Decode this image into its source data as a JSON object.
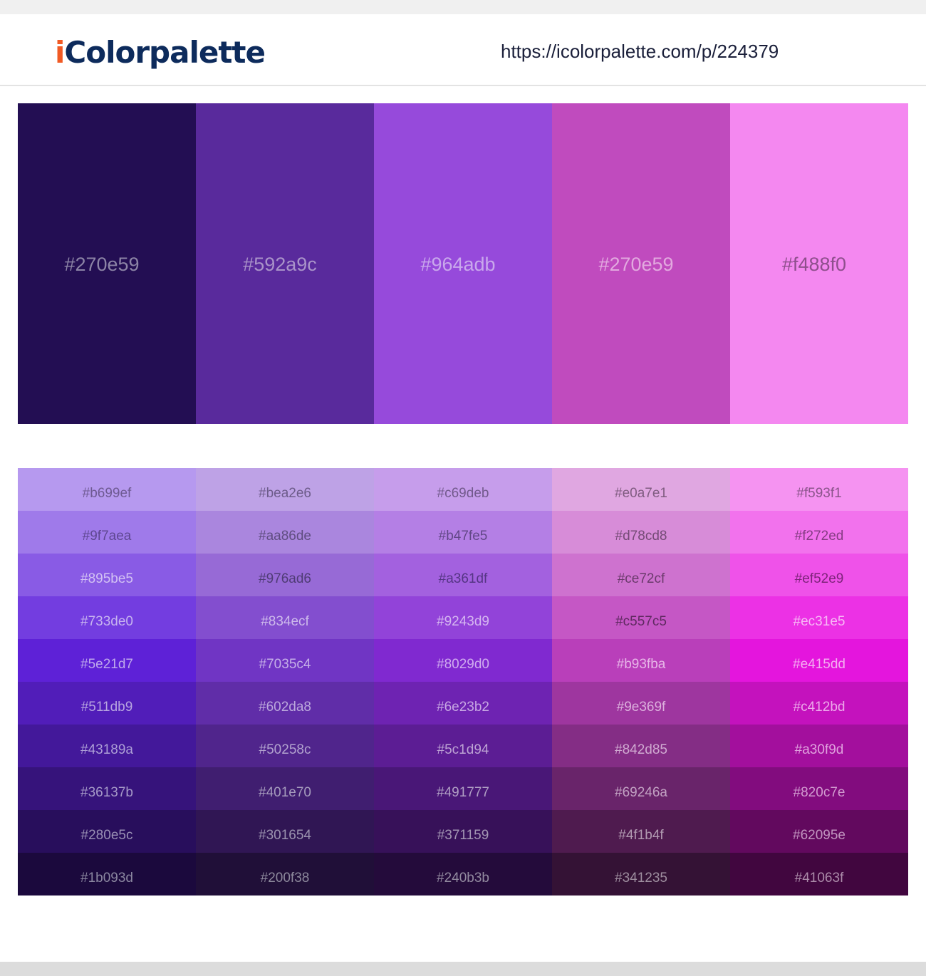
{
  "header": {
    "logo_first": "i",
    "logo_rest": "Colorpalette",
    "url": "https://icolorpalette.com/p/224379"
  },
  "colors": {
    "logo_accent": "#f15a24",
    "logo_main": "#0d2b5c"
  },
  "main_palette": [
    {
      "label": "#270e59",
      "color": "#230e53",
      "text_color": "#8c84a6"
    },
    {
      "label": "#592a9c",
      "color": "#592a9c",
      "text_color": "#a993c9"
    },
    {
      "label": "#964adb",
      "color": "#964adb",
      "text_color": "#c9a8ec"
    },
    {
      "label": "#270e59",
      "color": "#c04bbe",
      "text_color": "#e2a9df"
    },
    {
      "label": "#f488f0",
      "color": "#f488f0",
      "text_color": "#8e4f8c"
    }
  ],
  "shades": [
    {
      "column": 1,
      "cells": [
        {
          "label": "#b699ef",
          "color": "#b699ef",
          "text_color": "#6e5a92"
        },
        {
          "label": "#9f7aea",
          "color": "#9f7aea",
          "text_color": "#5f4892"
        },
        {
          "label": "#895be5",
          "color": "#895be5",
          "text_color": "#d3c2f3"
        },
        {
          "label": "#733de0",
          "color": "#733de0",
          "text_color": "#c7b4ef"
        },
        {
          "label": "#5e21d7",
          "color": "#5e21d7",
          "text_color": "#bea9ec"
        },
        {
          "label": "#511db9",
          "color": "#511db9",
          "text_color": "#b7a4e0"
        },
        {
          "label": "#43189a",
          "color": "#43189a",
          "text_color": "#ad9fd6"
        },
        {
          "label": "#36137b",
          "color": "#36137b",
          "text_color": "#a69ac8"
        },
        {
          "label": "#280e5c",
          "color": "#280e5c",
          "text_color": "#9a91b5"
        },
        {
          "label": "#1b093d",
          "color": "#1b093d",
          "text_color": "#8b87a0"
        }
      ]
    },
    {
      "column": 2,
      "cells": [
        {
          "label": "#bea2e6",
          "color": "#bea2e6",
          "text_color": "#6d5c8a"
        },
        {
          "label": "#aa86de",
          "color": "#aa86de",
          "text_color": "#5f4d80"
        },
        {
          "label": "#976ad6",
          "color": "#976ad6",
          "text_color": "#4f3c75"
        },
        {
          "label": "#834ecf",
          "color": "#834ecf",
          "text_color": "#cdbaeb"
        },
        {
          "label": "#7035c4",
          "color": "#7035c4",
          "text_color": "#c5b0e8"
        },
        {
          "label": "#602da8",
          "color": "#602da8",
          "text_color": "#bba8dc"
        },
        {
          "label": "#50258c",
          "color": "#50258c",
          "text_color": "#b2a3cf"
        },
        {
          "label": "#401e70",
          "color": "#401e70",
          "text_color": "#a69cbd"
        },
        {
          "label": "#301654",
          "color": "#301654",
          "text_color": "#9b93af"
        },
        {
          "label": "#200f38",
          "color": "#200f38",
          "text_color": "#8d899c"
        }
      ]
    },
    {
      "column": 3,
      "cells": [
        {
          "label": "#c69deb",
          "color": "#c69deb",
          "text_color": "#725a8c"
        },
        {
          "label": "#b47fe5",
          "color": "#b47fe5",
          "text_color": "#624787"
        },
        {
          "label": "#a361df",
          "color": "#a361df",
          "text_color": "#553584"
        },
        {
          "label": "#9243d9",
          "color": "#9243d9",
          "text_color": "#d5b6f0"
        },
        {
          "label": "#8029d0",
          "color": "#8029d0",
          "text_color": "#cfabef"
        },
        {
          "label": "#6e23b2",
          "color": "#6e23b2",
          "text_color": "#c7a7e3"
        },
        {
          "label": "#5c1d94",
          "color": "#5c1d94",
          "text_color": "#bda3d4"
        },
        {
          "label": "#491777",
          "color": "#491777",
          "text_color": "#b09fc4"
        },
        {
          "label": "#371159",
          "color": "#371159",
          "text_color": "#a396b3"
        },
        {
          "label": "#240b3b",
          "color": "#240b3b",
          "text_color": "#928a9f"
        }
      ]
    },
    {
      "column": 4,
      "cells": [
        {
          "label": "#e0a7e1",
          "color": "#e0a7e1",
          "text_color": "#7f5c80"
        },
        {
          "label": "#d78cd8",
          "color": "#d78cd8",
          "text_color": "#744a75"
        },
        {
          "label": "#ce72cf",
          "color": "#ce72cf",
          "text_color": "#6a3a6b"
        },
        {
          "label": "#c557c5",
          "color": "#c557c5",
          "text_color": "#5e2960"
        },
        {
          "label": "#b93fba",
          "color": "#b93fba",
          "text_color": "#e7b6e8"
        },
        {
          "label": "#9e369f",
          "color": "#9e369f",
          "text_color": "#dcb0dd"
        },
        {
          "label": "#842d85",
          "color": "#842d85",
          "text_color": "#d0aad1"
        },
        {
          "label": "#69246a",
          "color": "#69246a",
          "text_color": "#c2a2c3"
        },
        {
          "label": "#4f1b4f",
          "color": "#4f1b4f",
          "text_color": "#b19ab1"
        },
        {
          "label": "#341235",
          "color": "#341235",
          "text_color": "#9e8e9f"
        }
      ]
    },
    {
      "column": 5,
      "cells": [
        {
          "label": "#f593f1",
          "color": "#f593f1",
          "text_color": "#8a548a"
        },
        {
          "label": "#f272ed",
          "color": "#f272ed",
          "text_color": "#853c83"
        },
        {
          "label": "#ef52e9",
          "color": "#ef52e9",
          "text_color": "#7d237a"
        },
        {
          "label": "#ec31e5",
          "color": "#ec31e5",
          "text_color": "#f7b8f5"
        },
        {
          "label": "#e415dd",
          "color": "#e415dd",
          "text_color": "#f4aef1"
        },
        {
          "label": "#c412bd",
          "color": "#c412bd",
          "text_color": "#eca8ea"
        },
        {
          "label": "#a30f9d",
          "color": "#a30f9d",
          "text_color": "#e0a2de"
        },
        {
          "label": "#820c7e",
          "color": "#820c7e",
          "text_color": "#d29bd0"
        },
        {
          "label": "#62095e",
          "color": "#62095e",
          "text_color": "#c194bf"
        },
        {
          "label": "#41063f",
          "color": "#41063f",
          "text_color": "#ab8ba9"
        }
      ]
    }
  ]
}
